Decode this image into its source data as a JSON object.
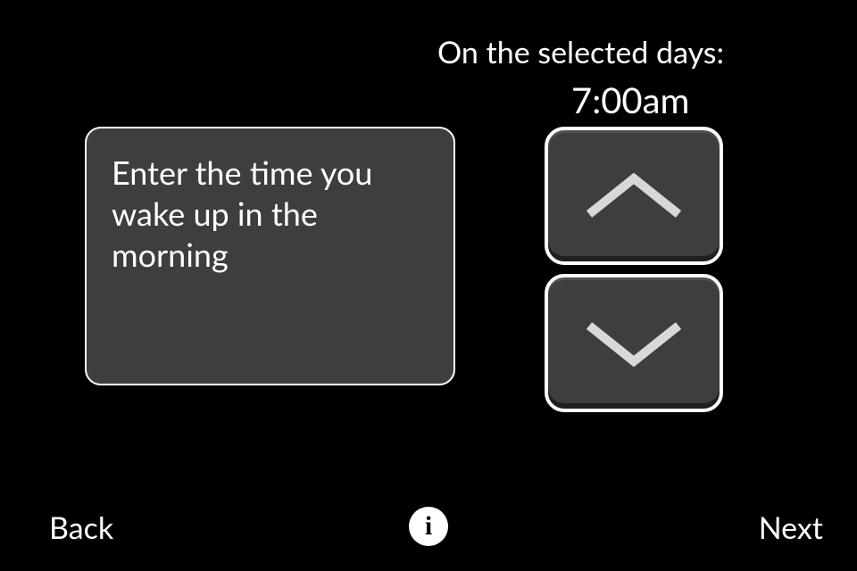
{
  "header": {
    "label": "On the selected days:"
  },
  "time": {
    "display": "7:00am"
  },
  "instruction": {
    "text": "Enter the time you wake up in the morning"
  },
  "nav": {
    "back": "Back",
    "next": "Next"
  },
  "info": {
    "glyph": "i"
  }
}
